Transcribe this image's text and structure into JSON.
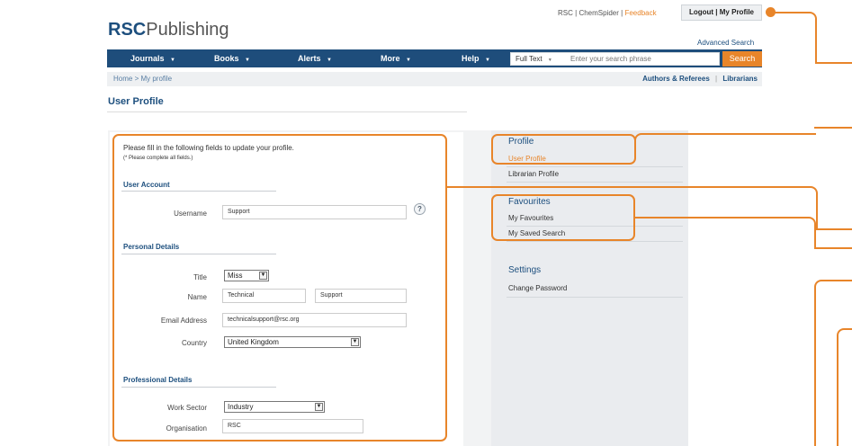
{
  "brand": {
    "logo_bold": "RSC",
    "logo_rest": "Publishing"
  },
  "top_links": {
    "rsc": "RSC",
    "chemspider": "ChemSpider",
    "feedback": "Feedback",
    "sep": "|"
  },
  "profile_tab": "Logout | My Profile",
  "advanced_search": "Advanced Search",
  "nav": {
    "items": [
      {
        "label": "Journals",
        "arrow": "▼"
      },
      {
        "label": "Books",
        "arrow": "▼"
      },
      {
        "label": "Alerts",
        "arrow": "▼"
      },
      {
        "label": "More",
        "arrow": "▼"
      },
      {
        "label": "Help",
        "arrow": "▼"
      }
    ]
  },
  "search": {
    "scope": "Full Text",
    "scope_arrow": "▼",
    "placeholder": "Enter your search phrase",
    "button": "Search"
  },
  "breadcrumb": "Home > My profile",
  "right_links": {
    "authors": "Authors & Referees",
    "sep": "|",
    "librarians": "Librarians"
  },
  "page_title": "User Profile",
  "form": {
    "intro": "Please fill in the following fields to update your profile.",
    "note": "(* Please complete all fields.)",
    "user_account": {
      "heading": "User Account",
      "username_label": "Username",
      "username_value": "Support"
    },
    "personal": {
      "heading": "Personal Details",
      "title_label": "Title",
      "title_value": "Miss",
      "name_label": "Name",
      "first_name": "Technical",
      "last_name": "Support",
      "email_label": "Email Address",
      "email_value": "technicalsupport@rsc.org",
      "country_label": "Country",
      "country_value": "United Kingdom"
    },
    "professional": {
      "heading": "Professional Details",
      "sector_label": "Work Sector",
      "sector_value": "Industry",
      "org_label": "Organisation",
      "org_value": "RSC"
    },
    "help_icon": "?"
  },
  "sidebar": {
    "profile": {
      "heading": "Profile",
      "items": [
        "User Profile",
        "Librarian Profile"
      ]
    },
    "favourites": {
      "heading": "Favourites",
      "items": [
        "My Favourites",
        "My Saved Search"
      ]
    },
    "settings": {
      "heading": "Settings",
      "items": [
        "Change Password"
      ]
    }
  },
  "colors": {
    "accent": "#e8852a",
    "nav": "#1e4d7b",
    "link": "#1d4f7e"
  }
}
